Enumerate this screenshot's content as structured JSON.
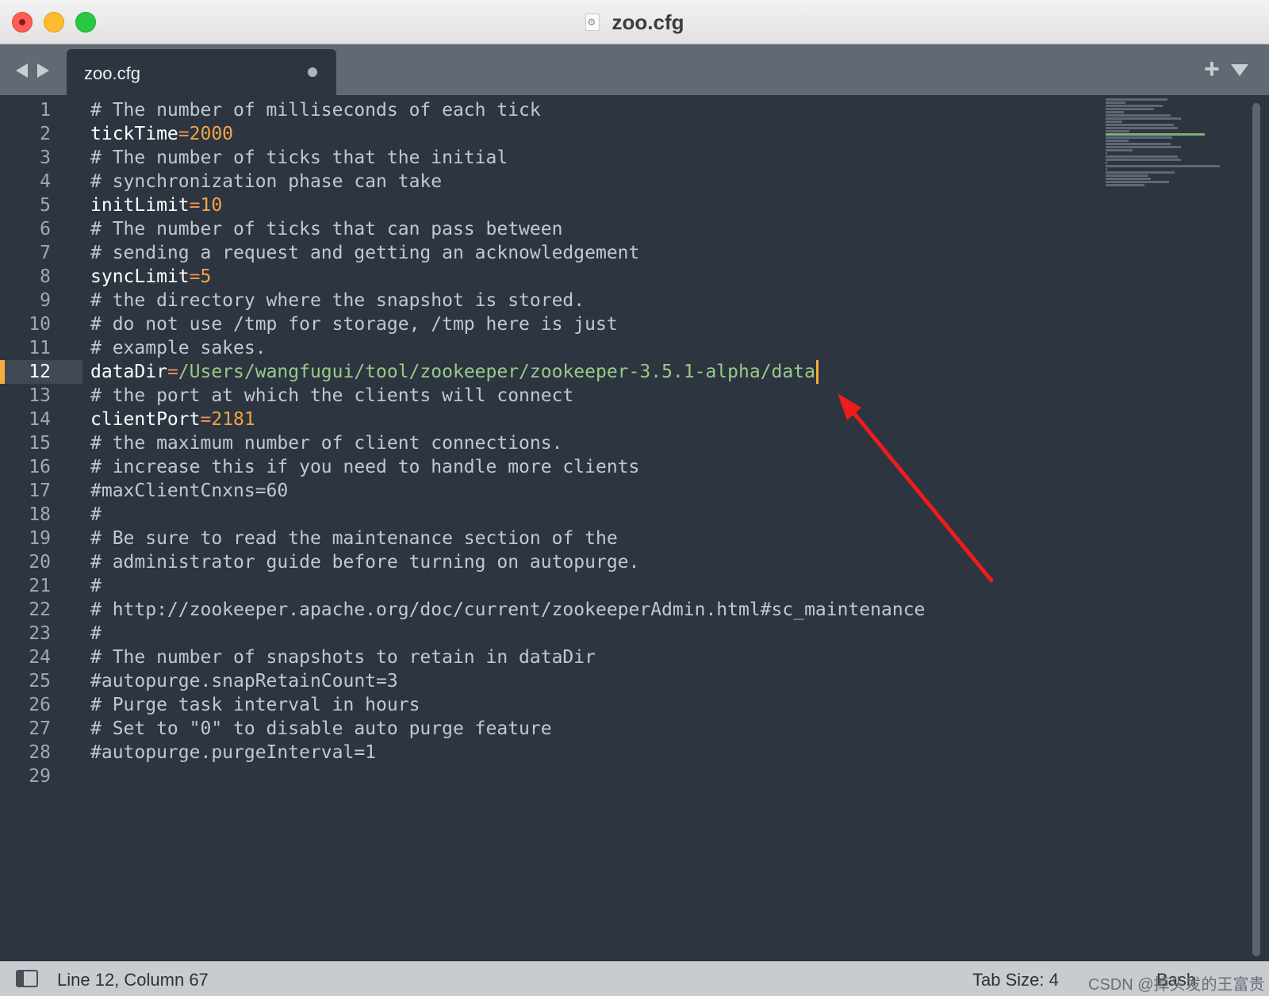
{
  "window": {
    "title": "zoo.cfg"
  },
  "tabs": [
    {
      "label": "zoo.cfg",
      "modified": true
    }
  ],
  "editor": {
    "current_line": 12,
    "lines": [
      {
        "n": "1",
        "segments": [
          {
            "t": "# The number of milliseconds of each tick",
            "c": "cmt"
          }
        ]
      },
      {
        "n": "2",
        "segments": [
          {
            "t": "tickTime",
            "c": "key"
          },
          {
            "t": "=",
            "c": "op"
          },
          {
            "t": "2000",
            "c": "num"
          }
        ]
      },
      {
        "n": "3",
        "segments": [
          {
            "t": "# The number of ticks that the initial",
            "c": "cmt"
          }
        ]
      },
      {
        "n": "4",
        "segments": [
          {
            "t": "# synchronization phase can take",
            "c": "cmt"
          }
        ]
      },
      {
        "n": "5",
        "segments": [
          {
            "t": "initLimit",
            "c": "key"
          },
          {
            "t": "=",
            "c": "op"
          },
          {
            "t": "10",
            "c": "num"
          }
        ]
      },
      {
        "n": "6",
        "segments": [
          {
            "t": "# The number of ticks that can pass between",
            "c": "cmt"
          }
        ]
      },
      {
        "n": "7",
        "segments": [
          {
            "t": "# sending a request and getting an acknowledgement",
            "c": "cmt"
          }
        ]
      },
      {
        "n": "8",
        "segments": [
          {
            "t": "syncLimit",
            "c": "key"
          },
          {
            "t": "=",
            "c": "op"
          },
          {
            "t": "5",
            "c": "num"
          }
        ]
      },
      {
        "n": "9",
        "segments": [
          {
            "t": "# the directory where the snapshot is stored.",
            "c": "cmt"
          }
        ]
      },
      {
        "n": "10",
        "segments": [
          {
            "t": "# do not use /tmp for storage, /tmp here is just",
            "c": "cmt"
          }
        ]
      },
      {
        "n": "11",
        "segments": [
          {
            "t": "# example sakes.",
            "c": "cmt"
          }
        ]
      },
      {
        "n": "12",
        "segments": [
          {
            "t": "dataDir",
            "c": "key"
          },
          {
            "t": "=",
            "c": "op"
          },
          {
            "t": "/Users/wangfugui/tool/zookeeper/zookeeper-3.5.1-alpha/data",
            "c": "str"
          }
        ],
        "cursor": true
      },
      {
        "n": "13",
        "segments": [
          {
            "t": "# the port at which the clients will connect",
            "c": "cmt"
          }
        ]
      },
      {
        "n": "14",
        "segments": [
          {
            "t": "clientPort",
            "c": "key"
          },
          {
            "t": "=",
            "c": "op"
          },
          {
            "t": "2181",
            "c": "num"
          }
        ]
      },
      {
        "n": "15",
        "segments": [
          {
            "t": "# the maximum number of client connections.",
            "c": "cmt"
          }
        ]
      },
      {
        "n": "16",
        "segments": [
          {
            "t": "# increase this if you need to handle more clients",
            "c": "cmt"
          }
        ]
      },
      {
        "n": "17",
        "segments": [
          {
            "t": "#maxClientCnxns=60",
            "c": "cmt"
          }
        ]
      },
      {
        "n": "18",
        "segments": [
          {
            "t": "#",
            "c": "cmt"
          }
        ]
      },
      {
        "n": "19",
        "segments": [
          {
            "t": "# Be sure to read the maintenance section of the",
            "c": "cmt"
          }
        ]
      },
      {
        "n": "20",
        "segments": [
          {
            "t": "# administrator guide before turning on autopurge.",
            "c": "cmt"
          }
        ]
      },
      {
        "n": "21",
        "segments": [
          {
            "t": "#",
            "c": "cmt"
          }
        ]
      },
      {
        "n": "22",
        "segments": [
          {
            "t": "# http://zookeeper.apache.org/doc/current/zookeeperAdmin.html#sc_maintenance",
            "c": "cmt"
          }
        ]
      },
      {
        "n": "23",
        "segments": [
          {
            "t": "#",
            "c": "cmt"
          }
        ]
      },
      {
        "n": "24",
        "segments": [
          {
            "t": "# The number of snapshots to retain in dataDir",
            "c": "cmt"
          }
        ]
      },
      {
        "n": "25",
        "segments": [
          {
            "t": "#autopurge.snapRetainCount=3",
            "c": "cmt"
          }
        ]
      },
      {
        "n": "26",
        "segments": [
          {
            "t": "# Purge task interval in hours",
            "c": "cmt"
          }
        ]
      },
      {
        "n": "27",
        "segments": [
          {
            "t": "# Set to \"0\" to disable auto purge feature",
            "c": "cmt"
          }
        ]
      },
      {
        "n": "28",
        "segments": [
          {
            "t": "#autopurge.purgeInterval=1",
            "c": "cmt"
          }
        ]
      },
      {
        "n": "29",
        "segments": []
      }
    ]
  },
  "status": {
    "position": "Line 12, Column 67",
    "tab_size": "Tab Size: 4",
    "syntax": "Bash",
    "watermark": "CSDN @掉头发的王富贵"
  },
  "colors": {
    "editor_bg": "#2c3540",
    "comment": "#c2c8cf",
    "key": "#ffffff",
    "operator": "#f28e56",
    "number": "#f7a445",
    "string": "#9acb86",
    "cursor": "#f4ac3f",
    "annotation_arrow": "#ee1c1c"
  },
  "icons": [
    "back-arrow-icon",
    "forward-arrow-icon",
    "plus-icon",
    "tab-menu-icon",
    "sidebar-toggle-icon",
    "document-gear-icon"
  ]
}
